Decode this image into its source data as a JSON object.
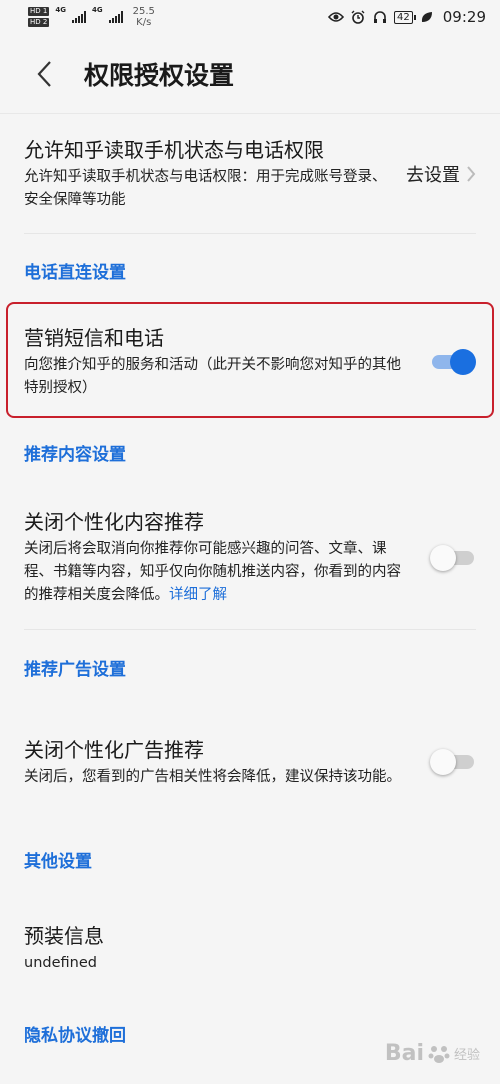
{
  "status_bar": {
    "hd1": "HD 1",
    "hd2": "HD 2",
    "net1": "4G",
    "net2": "4G",
    "speed_value": "25.5",
    "speed_unit": "K/s",
    "battery": "42",
    "time": "09:29"
  },
  "header": {
    "title": "权限授权设置"
  },
  "phone_permission": {
    "title": "允许知乎读取手机状态与电话权限",
    "desc": "允许知乎读取手机状态与电话权限：用于完成账号登录、安全保障等功能",
    "action_label": "去设置"
  },
  "sections": {
    "phone_direct": "电话直连设置",
    "recommend_content": "推荐内容设置",
    "recommend_ads": "推荐广告设置",
    "other": "其他设置",
    "privacy_revoke": "隐私协议撤回"
  },
  "marketing": {
    "title": "营销短信和电话",
    "desc": "向您推介知乎的服务和活动（此开关不影响您对知乎的其他特别授权）",
    "enabled": true
  },
  "personalized_content": {
    "title": "关闭个性化内容推荐",
    "desc": "关闭后将会取消向你推荐你可能感兴趣的问答、文章、课程、书籍等内容，知乎仅向你随机推送内容，你看到的内容的推荐相关度会降低。",
    "link": "详细了解",
    "enabled": false
  },
  "personalized_ads": {
    "title": "关闭个性化广告推荐",
    "desc": "关闭后，您看到的广告相关性将会降低，建议保持该功能。",
    "enabled": false
  },
  "preinstall": {
    "title": "预装信息",
    "value": "undefined"
  },
  "watermark": {
    "text": "Bai",
    "sub": "经验"
  },
  "colors": {
    "accent": "#1e6fd9",
    "switch_on": "#1a6fe0",
    "highlight": "#c8202c"
  }
}
